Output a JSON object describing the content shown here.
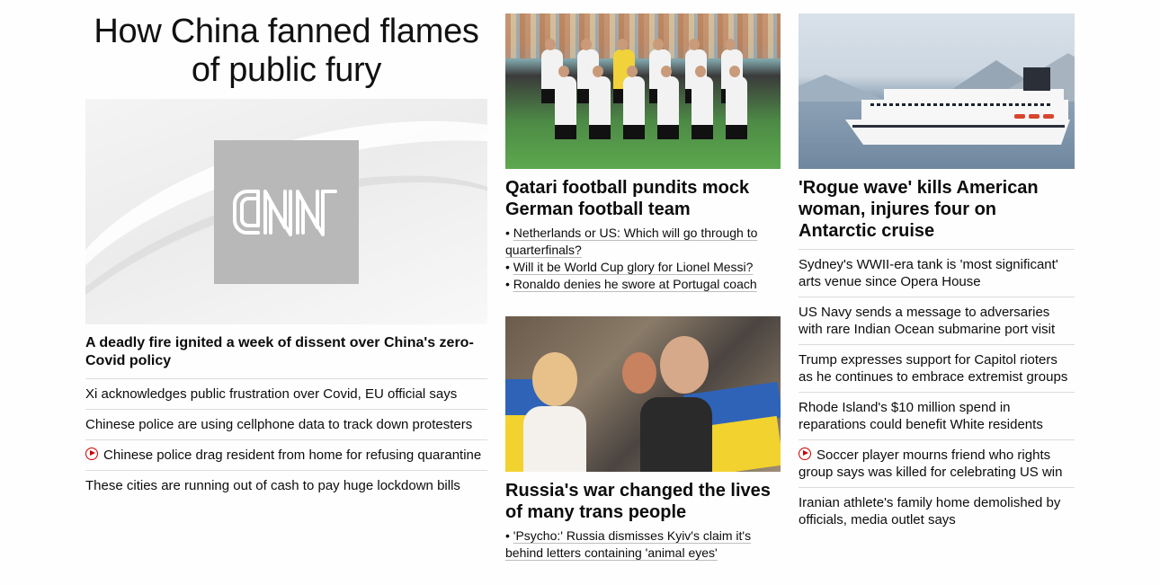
{
  "column1": {
    "headline": "How China fanned flames of public fury",
    "image_logo_text": "CNN",
    "lead_story": "A deadly fire ignited a week of dissent over China's zero-Covid policy",
    "related": [
      {
        "text": "Xi acknowledges public frustration over Covid, EU official says",
        "video": false
      },
      {
        "text": "Chinese police are using cellphone data to track down protesters",
        "video": false
      },
      {
        "text": "Chinese police drag resident from home for refusing quarantine",
        "video": true
      },
      {
        "text": "These cities are running out of cash to pay huge lockdown bills",
        "video": false
      }
    ]
  },
  "column2": {
    "story1": {
      "headline": "Qatari football pundits mock German football team",
      "bullets": [
        "Netherlands or US: Which will go through to quarterfinals?",
        "Will it be World Cup glory for Lionel Messi?",
        "Ronaldo denies he swore at Portugal coach"
      ]
    },
    "story2": {
      "headline": "Russia's war changed the lives of many trans people",
      "bullets": [
        "'Psycho:' Russia dismisses Kyiv's claim it's behind letters containing 'animal eyes'"
      ]
    }
  },
  "column3": {
    "headline": "'Rogue wave' kills American woman, injures four on Antarctic cruise",
    "related": [
      {
        "text": "Sydney's WWII-era tank is 'most significant' arts venue since Opera House",
        "video": false
      },
      {
        "text": "US Navy sends a message to adversaries with rare Indian Ocean submarine port visit",
        "video": false
      },
      {
        "text": "Trump expresses support for Capitol rioters as he continues to embrace extremist groups",
        "video": false
      },
      {
        "text": "Rhode Island's $10 million spend in reparations could benefit White residents",
        "video": false
      },
      {
        "text": "Soccer player mourns friend who rights group says was killed for celebrating US win",
        "video": true
      },
      {
        "text": "Iranian athlete's family home demolished by officials, media outlet says",
        "video": false
      }
    ]
  },
  "colors": {
    "accent_red": "#cc0000",
    "text": "#0c0c0c",
    "divider": "#dcdcdc"
  }
}
